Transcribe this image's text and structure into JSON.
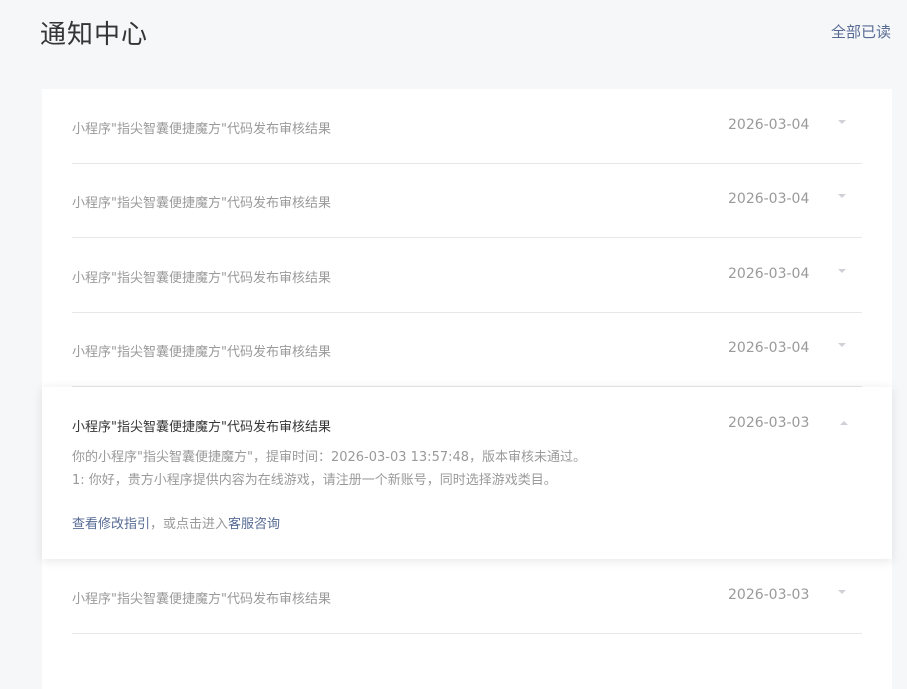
{
  "header": {
    "title": "通知中心",
    "mark_all_read": "全部已读"
  },
  "notifications": [
    {
      "title": "小程序\"指尖智囊便捷魔方\"代码发布审核结果",
      "date": "2026-03-04"
    },
    {
      "title": "小程序\"指尖智囊便捷魔方\"代码发布审核结果",
      "date": "2026-03-04"
    },
    {
      "title": "小程序\"指尖智囊便捷魔方\"代码发布审核结果",
      "date": "2026-03-04"
    },
    {
      "title": "小程序\"指尖智囊便捷魔方\"代码发布审核结果",
      "date": "2026-03-04"
    },
    {
      "title": "小程序\"指尖智囊便捷魔方\"代码发布审核结果",
      "date": "2026-03-03"
    }
  ],
  "expanded": {
    "title": "小程序\"指尖智囊便捷魔方\"代码发布审核结果",
    "date": "2026-03-03",
    "body_line1": "你的小程序\"指尖智囊便捷魔方\"，提审时间：2026-03-03 13:57:48，版本审核未通过。",
    "body_line2": "1: 你好，贵方小程序提供内容为在线游戏，请注册一个新账号，同时选择游戏类目。",
    "link_guide": "查看修改指引",
    "middle_text": "，或点击进入",
    "link_support": "客服咨询"
  }
}
